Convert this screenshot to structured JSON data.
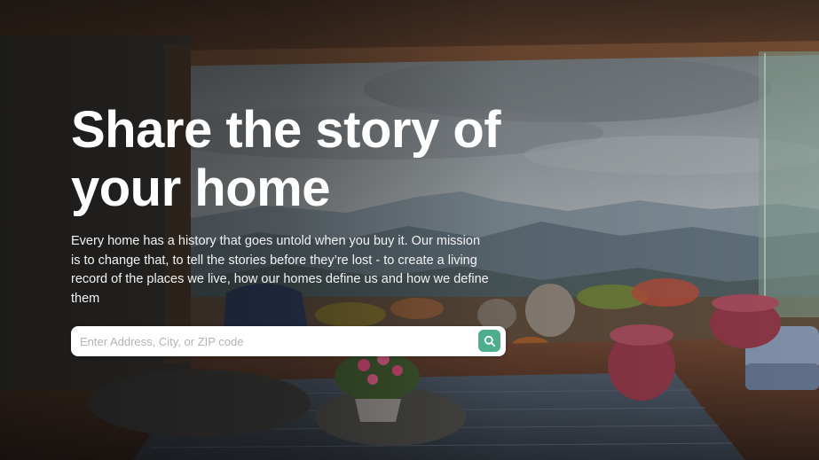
{
  "hero": {
    "background_image": "Open terrace living room overlooking a mountain valley under a cloudy sky",
    "headline": "Share the story of your home",
    "description": "Every home has a history that goes untold when you buy it. Our mission is to change that, to tell the stories before they’re lost - to create a living record of the places we live, how our homes define us and how we define them"
  },
  "search": {
    "placeholder": "Enter Address, City, or ZIP code",
    "value": "",
    "button_icon": "search-icon"
  },
  "colors": {
    "accent": "#4cae8a",
    "headline_text": "#ffffff",
    "body_text": "#f3f3f3",
    "input_background": "#ffffff",
    "placeholder_text": "#b3b3b3"
  }
}
